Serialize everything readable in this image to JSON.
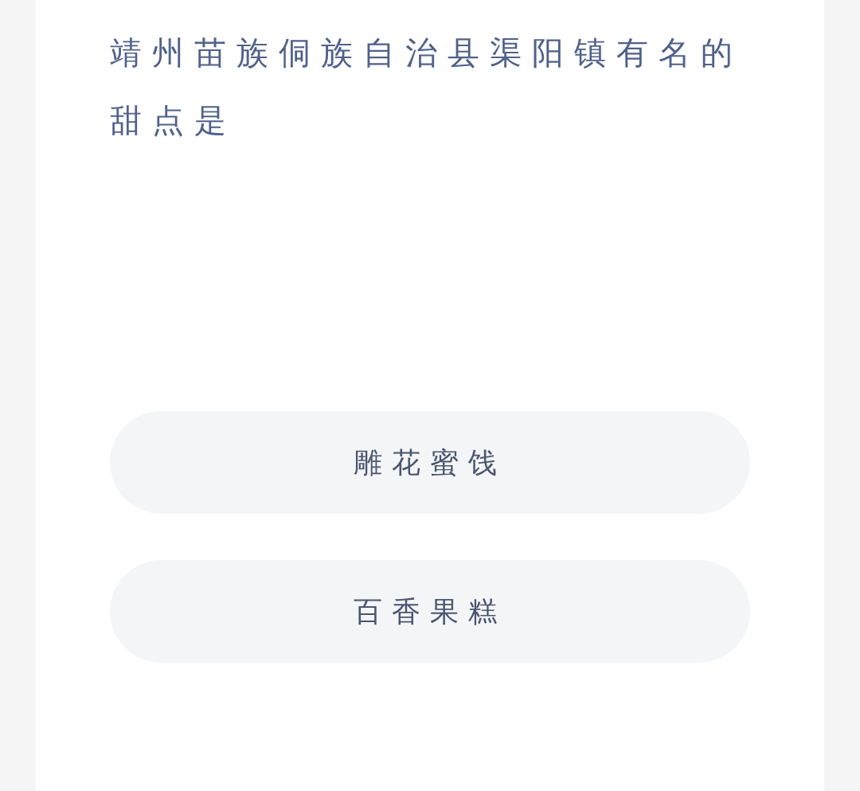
{
  "question": "靖州苗族侗族自治县渠阳镇有名的甜点是",
  "options": [
    {
      "label": "雕花蜜饯"
    },
    {
      "label": "百香果糕"
    }
  ]
}
